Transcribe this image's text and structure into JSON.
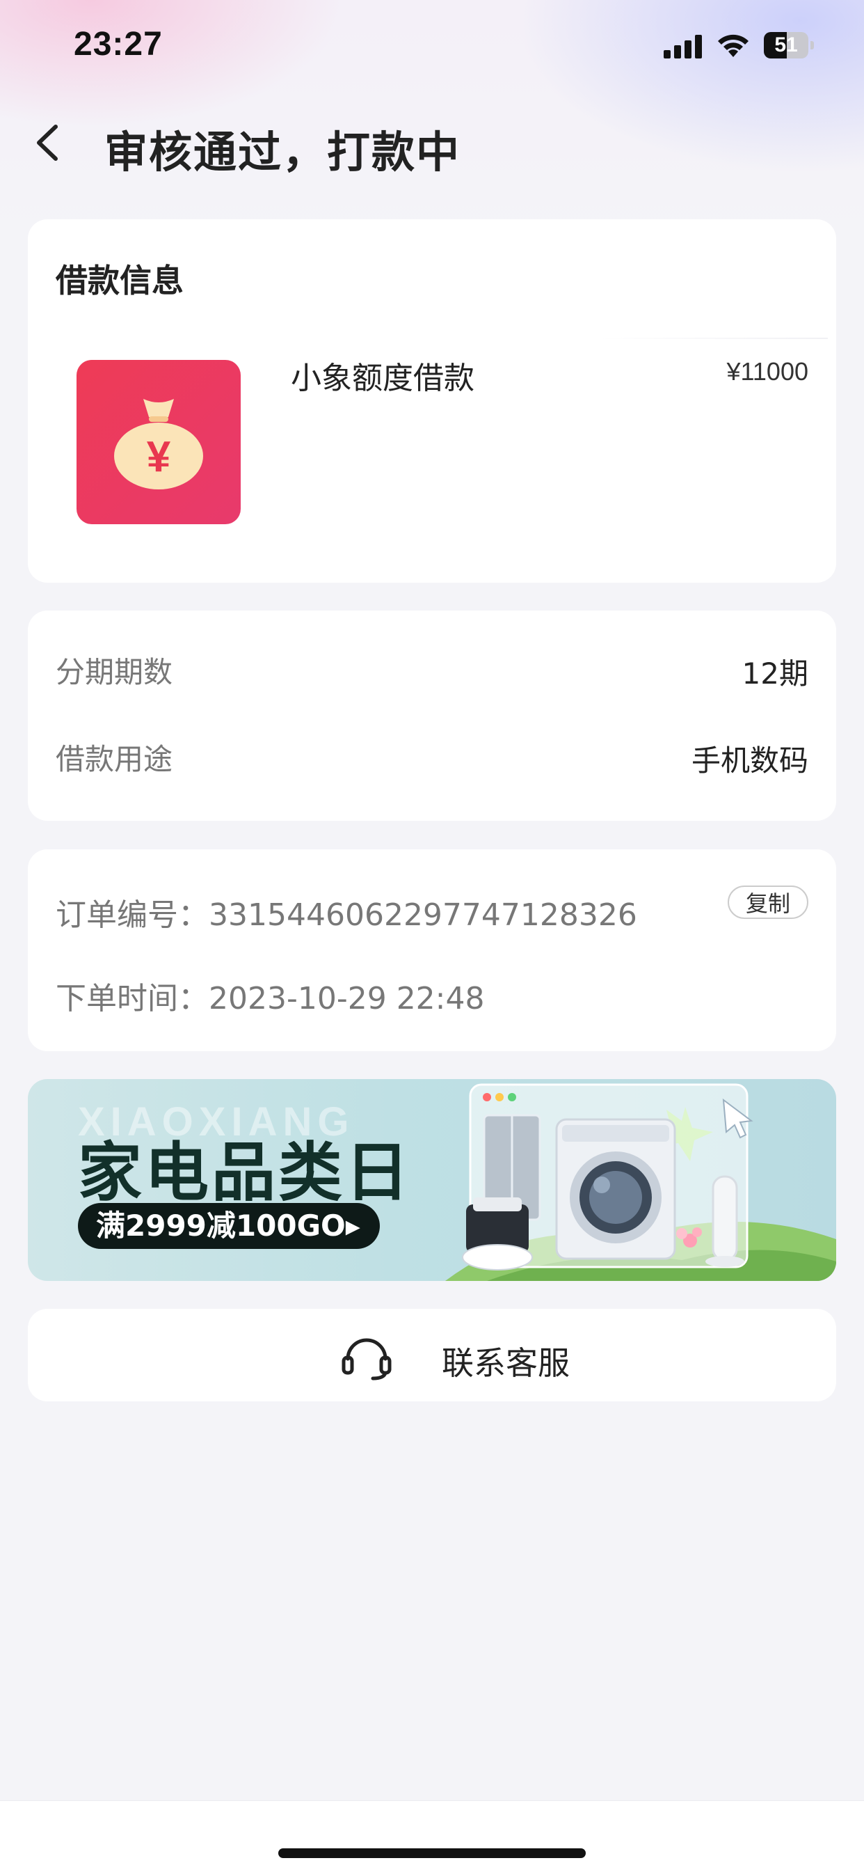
{
  "status_bar": {
    "time": "23:27",
    "battery": "51",
    "battery_level": 0.51
  },
  "nav": {
    "title": "审核通过，打款中"
  },
  "loan_card": {
    "heading": "借款信息",
    "product_name": "小象额度借款",
    "amount": "¥11000",
    "icon": "money-bag-icon",
    "icon_colors": [
      "#ee3b56",
      "#e83a6c"
    ]
  },
  "details": {
    "installments_label": "分期期数",
    "installments_value": "12期",
    "purpose_label": "借款用途",
    "purpose_value": "手机数码"
  },
  "order": {
    "number_text": "订单编号：3315446062297747128326",
    "time_text": "下单时间：2023-10-29 22:48",
    "copy_label": "复制"
  },
  "banner": {
    "watermark": "XIAOXIANG",
    "title": "家电品类日",
    "promo": "满2999减100GO",
    "arrow": "▸"
  },
  "service": {
    "label": "联系客服",
    "icon": "headset-icon"
  }
}
